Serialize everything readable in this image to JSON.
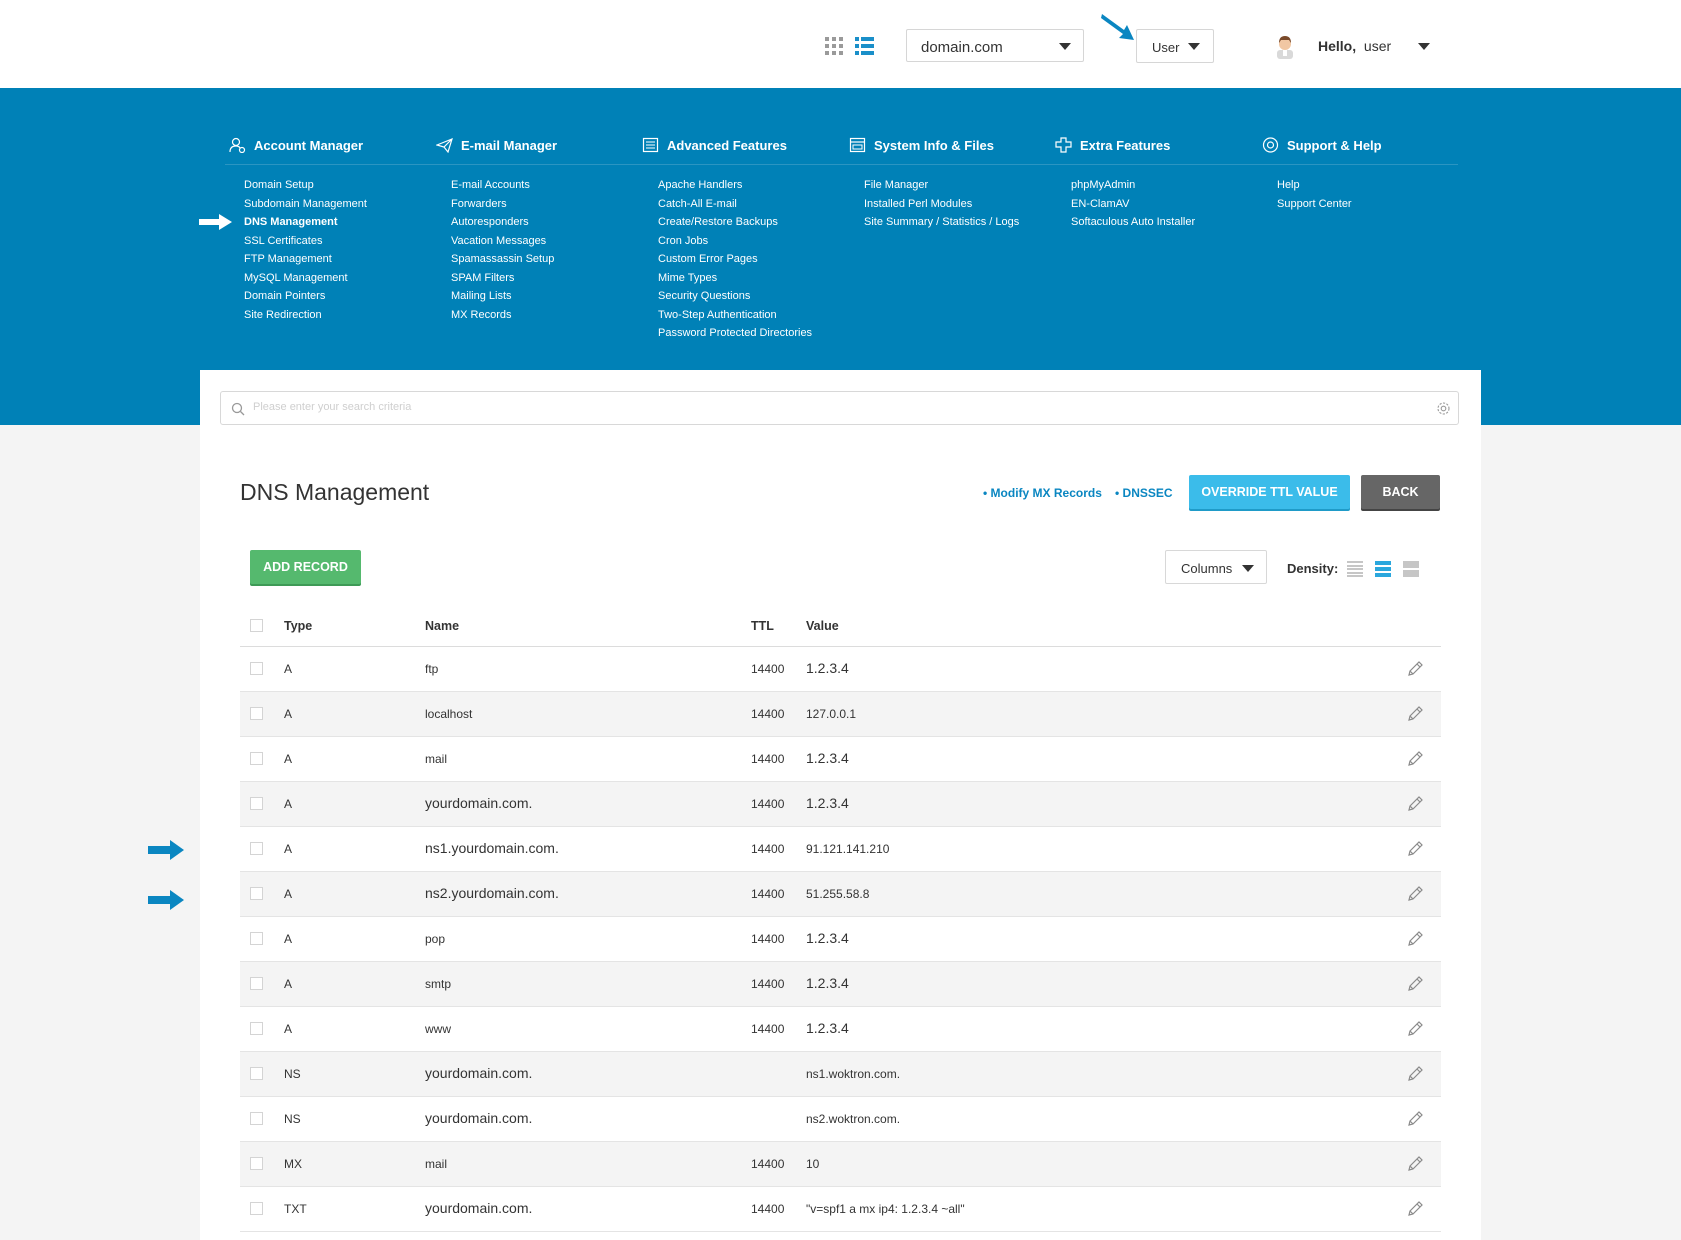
{
  "header": {
    "domain_select": "domain.com",
    "user_select": "User",
    "hello_label": "Hello,",
    "username": "user"
  },
  "menu": [
    {
      "title": "Account Manager",
      "icon": "account-icon",
      "items": [
        "Domain Setup",
        "Subdomain Management",
        "DNS Management",
        "SSL Certificates",
        "FTP Management",
        "MySQL Management",
        "Domain Pointers",
        "Site Redirection"
      ]
    },
    {
      "title": "E-mail Manager",
      "icon": "paper-plane-icon",
      "items": [
        "E-mail Accounts",
        "Forwarders",
        "Autoresponders",
        "Vacation Messages",
        "Spamassassin Setup",
        "SPAM Filters",
        "Mailing Lists",
        "MX Records"
      ]
    },
    {
      "title": "Advanced Features",
      "icon": "document-icon",
      "items": [
        "Apache Handlers",
        "Catch-All E-mail",
        "Create/Restore Backups",
        "Cron Jobs",
        "Custom Error Pages",
        "Mime Types",
        "Security Questions",
        "Two-Step Authentication",
        "Password Protected Directories"
      ]
    },
    {
      "title": "System Info & Files",
      "icon": "browser-icon",
      "items": [
        "File Manager",
        "Installed Perl Modules",
        "Site Summary / Statistics / Logs"
      ]
    },
    {
      "title": "Extra Features",
      "icon": "plus-icon",
      "items": [
        "phpMyAdmin",
        "EN-ClamAV",
        "Softaculous Auto Installer"
      ]
    },
    {
      "title": "Support & Help",
      "icon": "lifebuoy-icon",
      "items": [
        "Help",
        "Support Center"
      ]
    }
  ],
  "search": {
    "placeholder": "Please enter your search criteria"
  },
  "page": {
    "title": "DNS Management",
    "link_mx": "• Modify MX Records",
    "link_dnssec": "• DNSSEC",
    "btn_override": "OVERRIDE TTL VALUE",
    "btn_back": "BACK",
    "btn_add": "ADD RECORD",
    "btn_columns": "Columns",
    "density_label": "Density:"
  },
  "table": {
    "columns": [
      "Type",
      "Name",
      "TTL",
      "Value"
    ],
    "rows": [
      {
        "type": "A",
        "name": "ftp",
        "ttl": "14400",
        "value": "1.2.3.4"
      },
      {
        "type": "A",
        "name": "localhost",
        "ttl": "14400",
        "value": "127.0.0.1"
      },
      {
        "type": "A",
        "name": "mail",
        "ttl": "14400",
        "value": "1.2.3.4"
      },
      {
        "type": "A",
        "name": "yourdomain.com.",
        "ttl": "14400",
        "value": "1.2.3.4"
      },
      {
        "type": "A",
        "name": "ns1.yourdomain.com.",
        "ttl": "14400",
        "value": "91.121.141.210"
      },
      {
        "type": "A",
        "name": "ns2.yourdomain.com.",
        "ttl": "14400",
        "value": "51.255.58.8"
      },
      {
        "type": "A",
        "name": "pop",
        "ttl": "14400",
        "value": "1.2.3.4"
      },
      {
        "type": "A",
        "name": "smtp",
        "ttl": "14400",
        "value": "1.2.3.4"
      },
      {
        "type": "A",
        "name": "www",
        "ttl": "14400",
        "value": "1.2.3.4"
      },
      {
        "type": "NS",
        "name": "yourdomain.com.",
        "ttl": "",
        "value": "ns1.woktron.com."
      },
      {
        "type": "NS",
        "name": "yourdomain.com.",
        "ttl": "",
        "value": "ns2.woktron.com."
      },
      {
        "type": "MX",
        "name": "mail",
        "ttl": "14400",
        "value": "10"
      },
      {
        "type": "TXT",
        "name": "yourdomain.com.",
        "ttl": "14400",
        "value": "\"v=spf1 a mx ip4: 1.2.3.4  ~all\""
      }
    ]
  },
  "colors": {
    "brand_blue": "#0081b7",
    "accent_cyan": "#3bbcea",
    "add_green": "#55b96e",
    "annotation_arrow": "#0a86c1"
  }
}
